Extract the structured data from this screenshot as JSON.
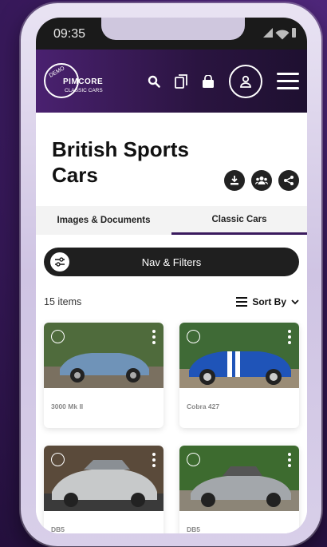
{
  "status": {
    "time": "09:35"
  },
  "header": {
    "logo_badge": "DEMO",
    "logo_name": "PIMCORE",
    "logo_sub": "CLASSIC CARS",
    "icons": [
      "search-icon",
      "compare-icon",
      "cart-icon"
    ]
  },
  "page": {
    "title": "British Sports Cars",
    "actions": [
      "download-icon",
      "people-icon",
      "share-icon"
    ]
  },
  "tabs": [
    {
      "label": "Images & Documents",
      "active": false
    },
    {
      "label": "Classic Cars",
      "active": true
    }
  ],
  "nav": {
    "label": "Nav & Filters"
  },
  "list": {
    "count": "15 items",
    "sort_label": "Sort By"
  },
  "items": [
    {
      "label": "3000 Mk II",
      "color": "#5b82a8"
    },
    {
      "label": "Cobra 427",
      "color": "#1f54b8"
    },
    {
      "label": "DB5",
      "color": "#b8babb"
    },
    {
      "label": "DB5",
      "color": "#9ea2a6"
    }
  ]
}
